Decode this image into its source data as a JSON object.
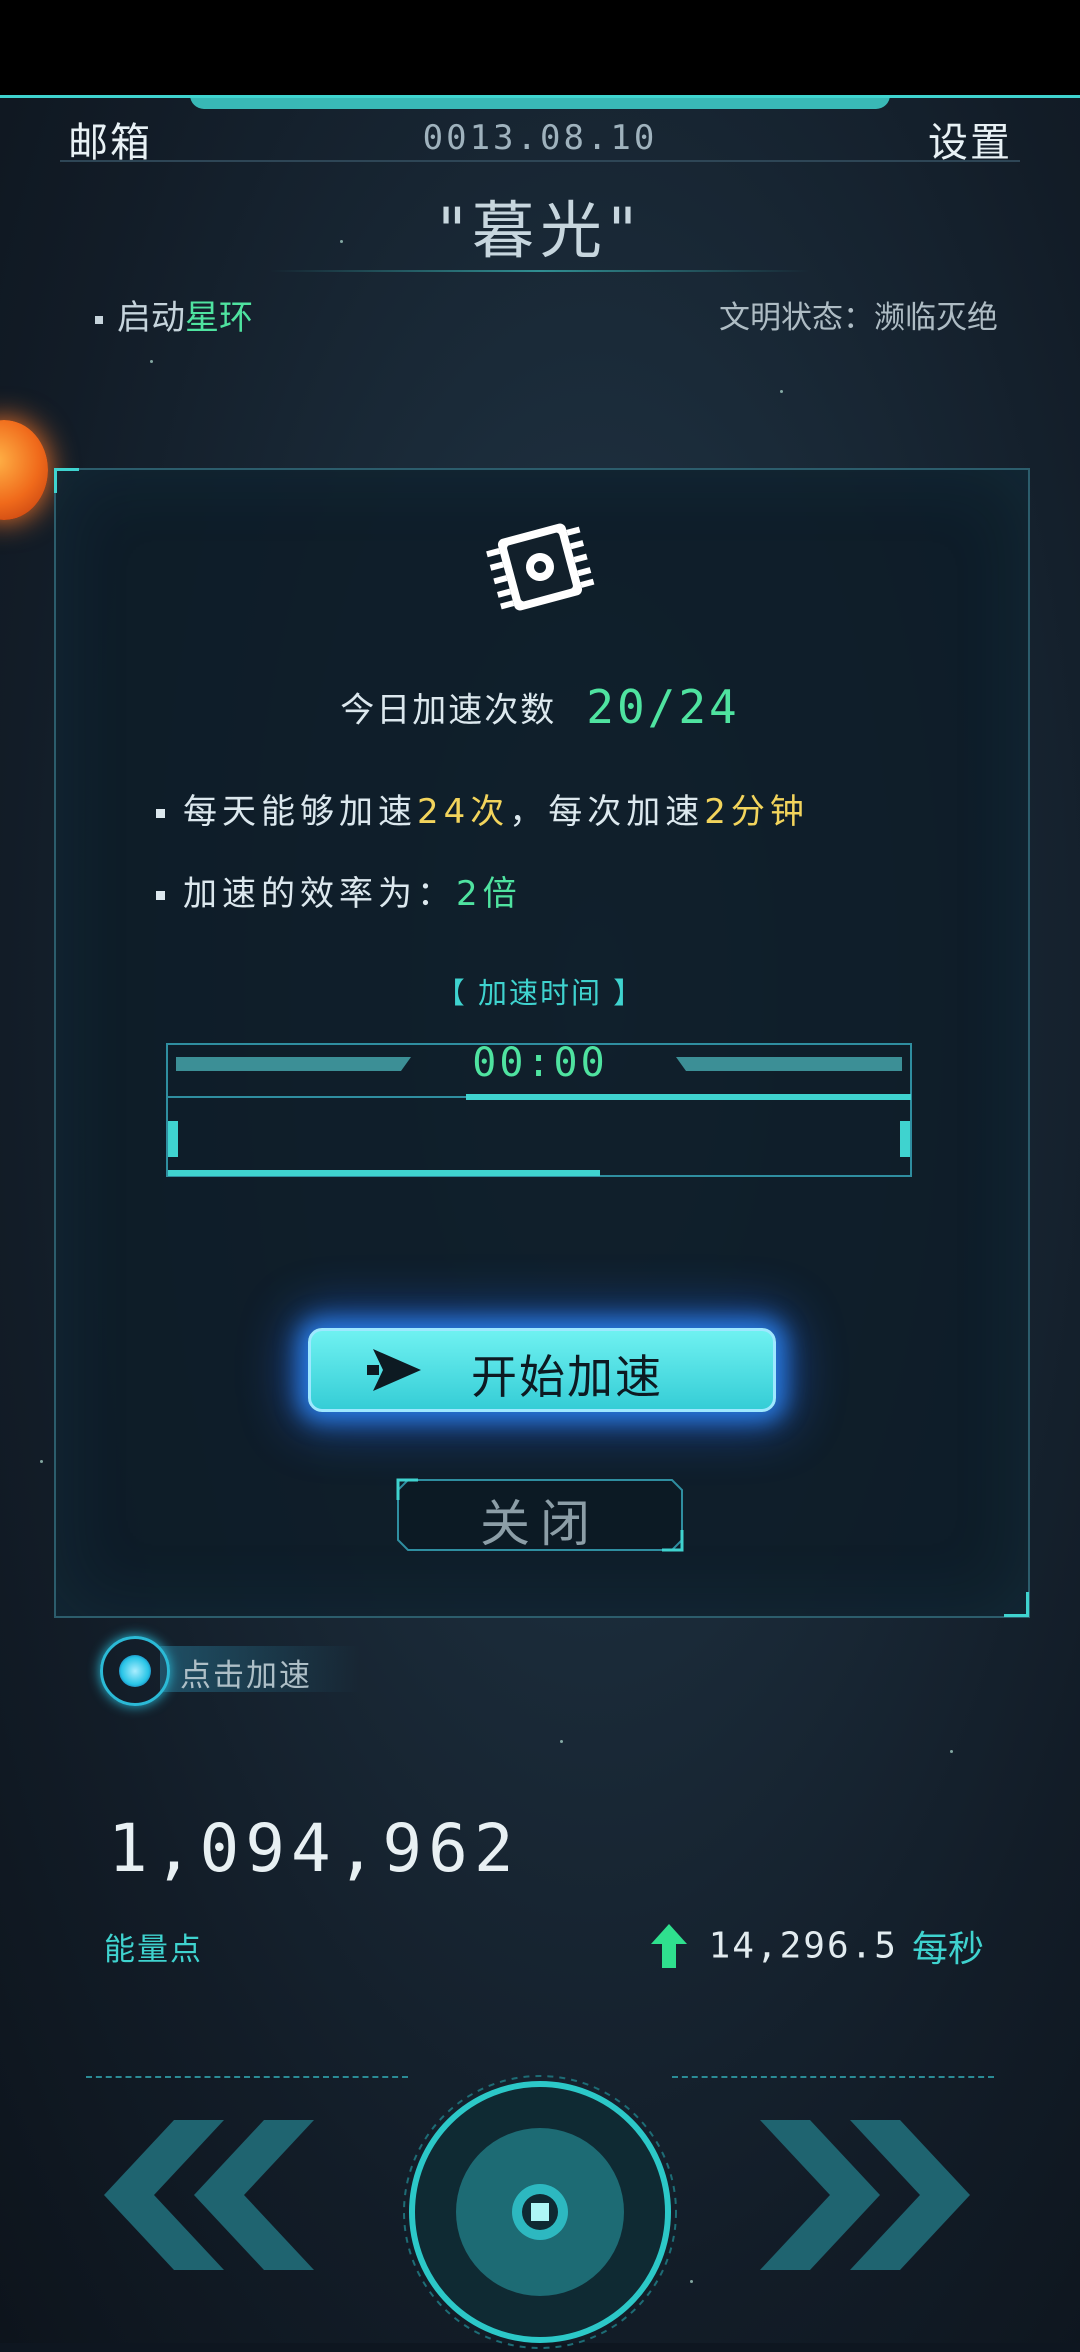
{
  "header": {
    "mail_label": "邮箱",
    "date": "0013.08.10",
    "settings_label": "设置",
    "planet_name": "\"暮光\""
  },
  "status": {
    "launch_prefix": "启动",
    "launch_highlight": "星环",
    "civilization_status": "文明状态：濒临灭绝"
  },
  "panel": {
    "count_label": "今日加速次数",
    "count_value": "20/24",
    "rule1_a": "每天能够加速",
    "rule1_b": "24次",
    "rule1_c": "，每次加速",
    "rule1_d": "2分钟",
    "rule2_a": "加速的效率为：",
    "rule2_b": "2倍",
    "time_title": "【 加速时间 】",
    "time_value": "00:00",
    "progress_fraction": 0.0,
    "start_button": "开始加速",
    "close_button": "关闭"
  },
  "tap_hint": "点击加速",
  "resources": {
    "energy_value": "1,094,962",
    "energy_label": "能量点",
    "rate_value": "14,296.5",
    "rate_unit": "每秒"
  },
  "colors": {
    "accent": "#3fd3cf",
    "green": "#4fe3a0",
    "yellow": "#f2d45c"
  }
}
